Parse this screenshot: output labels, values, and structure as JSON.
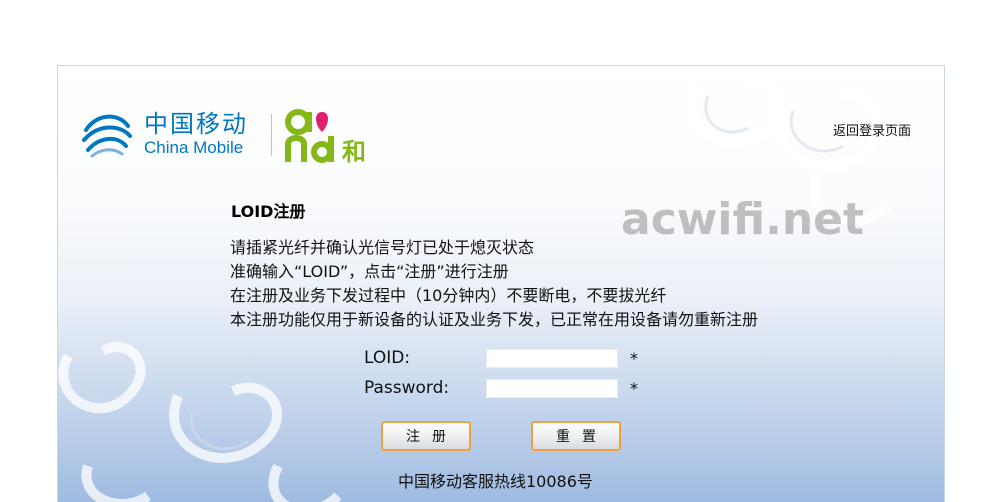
{
  "brand": {
    "cn_name": "中国移动",
    "en_name": "China Mobile",
    "and_suffix": "和",
    "colors": {
      "cm_blue": "#0077c0",
      "and_green": "#84b817",
      "and_magenta": "#e0206e"
    }
  },
  "header": {
    "return_link": "返回登录页面"
  },
  "watermark": "acwifi.net",
  "main": {
    "title": "LOID注册",
    "notes": [
      "请插紧光纤并确认光信号灯已处于熄灭状态",
      "准确输入“LOID”，点击“注册”进行注册",
      "在注册及业务下发过程中（10分钟内）不要断电，不要拔光纤",
      "本注册功能仅用于新设备的认证及业务下发，已正常在用设备请勿重新注册"
    ]
  },
  "form": {
    "loid": {
      "label": "LOID:",
      "value": "",
      "required_mark": "*"
    },
    "password": {
      "label": "Password:",
      "value": "",
      "required_mark": "*"
    },
    "register_button": "注册",
    "reset_button": "重置"
  },
  "footer": {
    "hotline": "中国移动客服热线10086号"
  },
  "colors": {
    "button_border": "#f0a040",
    "panel_bottom": "#9fbbe1"
  }
}
